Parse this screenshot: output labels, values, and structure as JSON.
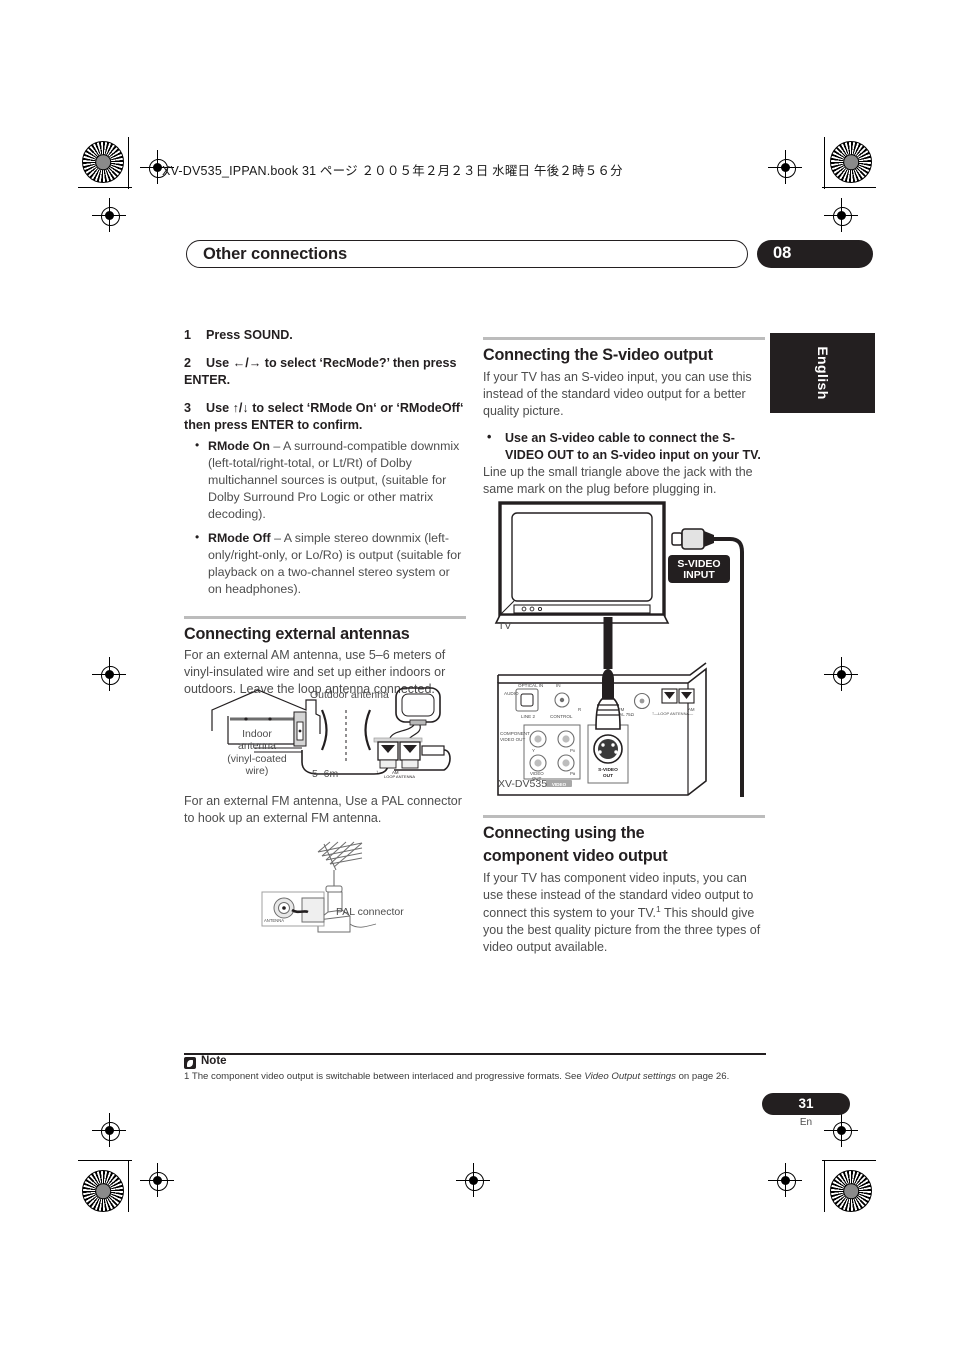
{
  "book_header": "XV-DV535_IPPAN.book  31 ページ  ２００５年２月２３日   水曜日   午後２時５６分",
  "chapter": {
    "title": "Other connections",
    "number": "08"
  },
  "language_tab": "English",
  "left_column": {
    "steps": [
      {
        "num": "1",
        "text": "Press SOUND."
      },
      {
        "num": "2",
        "text": "Use ←/→ to select ‘RecMode?’ then press ENTER."
      },
      {
        "num": "3",
        "text": "Use ↑/↓ to select ‘RMode On‘ or ‘RModeOff‘ then press ENTER to confirm."
      }
    ],
    "bullets": [
      {
        "term": "RMode On",
        "text": " – A surround-compatible downmix (left-total/right-total, or Lt/Rt) of Dolby multichannel sources is output, (suitable for Dolby Surround Pro Logic or other matrix decoding)."
      },
      {
        "term": "RMode Off",
        "text": " – A simple stereo downmix (left-only/right-only, or Lo/Ro) is output (suitable for playback on a two-channel stereo system or on headphones)."
      }
    ],
    "antenna_section": {
      "heading": "Connecting external antennas",
      "paragraph_am": "For an external AM antenna, use 5–6 meters of vinyl-insulated wire and set up either indoors or outdoors. Leave the loop antenna connected.",
      "paragraph_fm": "For an external FM antenna, Use a PAL connector to hook up an external FM antenna.",
      "figure_am": {
        "outdoor_label": "Outdoor antenna",
        "indoor_label_line1": "Indoor",
        "indoor_label_line2": "antenna",
        "indoor_label_line3": "(vinyl-coated",
        "indoor_label_line4": "wire)",
        "length_label": "5–6m",
        "terminal_left": "⏚",
        "terminal_right": "AM",
        "terminal_caption": "LOOP ANTENNA"
      },
      "figure_fm": {
        "pal_label": "PAL connector",
        "jack_label": "ANTENNA"
      }
    }
  },
  "right_column": {
    "svideo_section": {
      "heading": "Connecting the S-video output",
      "paragraph": "If your TV has an S-video input, you can use this instead of the standard video output for a better quality picture.",
      "bullet_bold": "Use an S-video cable to connect the S-VIDEO OUT to an S-video input on your TV.",
      "bullet_rest": "Line up the small triangle above the jack with the same mark on the plug before plugging in.",
      "figure": {
        "tv_label": "TV",
        "input_badge_line1": "S-VIDEO",
        "input_badge_line2": "INPUT",
        "unit_label": "XV-DV535",
        "rear_labels": {
          "audio": "AUDIO",
          "optical_in": "OPTICAL IN",
          "line2": "LINE 2",
          "in": "IN",
          "control": "CONTROL",
          "component": "COMPONENT VIDEO OUT",
          "y": "Y",
          "pb": "PB",
          "pr": "PR",
          "video_out": "VIDEO OUT",
          "video": "VIDEO",
          "svideo_out": "S-VIDEO OUT",
          "fm_unbal": "FM UNBAL 75Ω",
          "loop_antenna": "LOOP ANTENNA",
          "am": "AM",
          "r": "R"
        }
      }
    },
    "component_section": {
      "heading_line1": "Connecting using the",
      "heading_line2": "component video output",
      "paragraph_part1": "If your TV has component video inputs, you can use these instead of the standard video output to connect this system to your TV.",
      "footnote_marker": "1",
      "paragraph_part2": " This should give you the best quality picture from the three types of video output available."
    }
  },
  "note": {
    "label": "Note",
    "marker": "1",
    "text_before_italic": "The component video output is switchable between interlaced and progressive formats. See ",
    "italic": "Video Output settings",
    "text_after_italic": " on page 26."
  },
  "footer": {
    "page_number": "31",
    "page_lang": "En"
  }
}
